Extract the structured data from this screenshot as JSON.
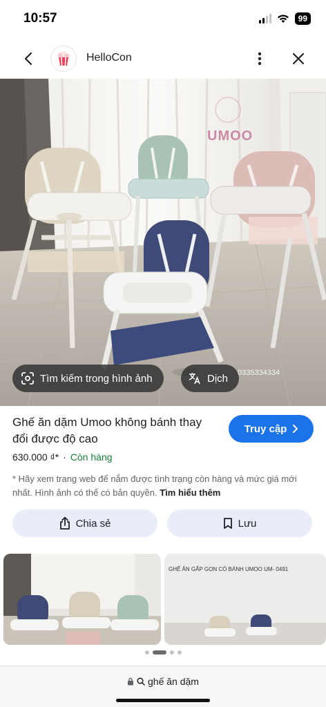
{
  "status": {
    "time": "10:57",
    "battery": "99"
  },
  "browser": {
    "site_name": "HelloCon"
  },
  "hero": {
    "brand_watermark": "UMOO",
    "phone_watermark": "0335334334",
    "lens_label": "Tìm kiếm trong hình ảnh",
    "translate_label": "Dịch"
  },
  "product": {
    "title": "Ghế ăn dặm Umoo không bánh thay đổi được độ cao",
    "visit_label": "Truy cập",
    "price": "630.000 ₫*",
    "separator": "·",
    "stock": "Còn hàng",
    "notice": "* Hãy xem trang web để nắm được tình trạng còn hàng và mức giá mới nhất. Hình ảnh có thể có bản quyền.",
    "learn_more": "Tìm hiểu thêm"
  },
  "actions": {
    "share_label": "Chia sẻ",
    "save_label": "Lưu"
  },
  "related": {
    "caption_2": "GHẾ ĂN GẤP GỌN CÓ BÁNH UMOO UM- 0491"
  },
  "pager": {
    "count": 4,
    "active_index": 1
  },
  "address_bar": {
    "query": "ghế ăn dặm"
  },
  "colors": {
    "accent": "#1a73e8",
    "stock": "#188038",
    "chip_bg": "#e8edf9"
  }
}
